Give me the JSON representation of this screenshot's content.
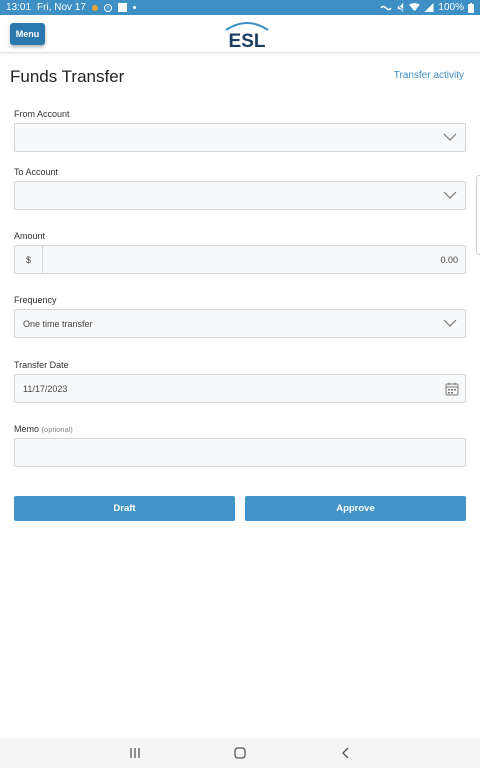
{
  "status_bar": {
    "time": "13:01",
    "date": "Fri, Nov 17",
    "battery": "100%"
  },
  "header": {
    "menu_label": "Menu",
    "logo_text": "ESL"
  },
  "page": {
    "title": "Funds Transfer",
    "activity_link": "Transfer activity"
  },
  "form": {
    "from_account": {
      "label": "From Account",
      "value": ""
    },
    "to_account": {
      "label": "To Account",
      "value": ""
    },
    "amount": {
      "label": "Amount",
      "currency": "$",
      "value": "0.00"
    },
    "frequency": {
      "label": "Frequency",
      "value": "One time transfer"
    },
    "transfer_date": {
      "label": "Transfer Date",
      "value": "11/17/2023"
    },
    "memo": {
      "label": "Memo",
      "optional": "(optional)",
      "value": ""
    }
  },
  "buttons": {
    "draft": "Draft",
    "approve": "Approve"
  },
  "colors": {
    "accent": "#3d8fc4",
    "button": "#4293c8",
    "menu": "#2a78ad"
  },
  "icons": [
    "chevron-down-icon",
    "calendar-icon",
    "recents-icon",
    "home-icon",
    "back-icon"
  ]
}
